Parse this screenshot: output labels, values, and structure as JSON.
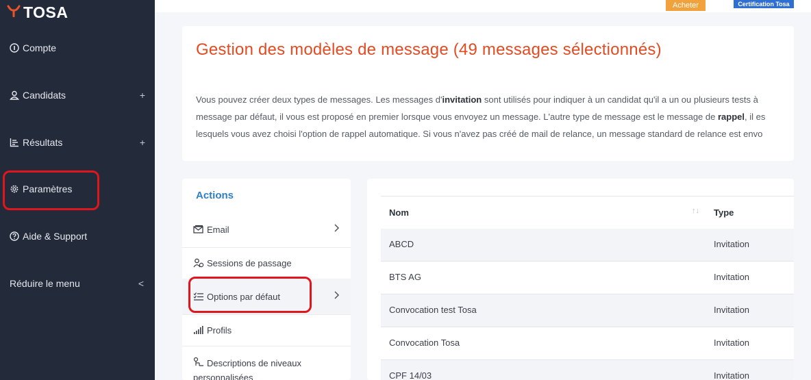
{
  "brand": {
    "name": "TOSA"
  },
  "topbar": {
    "buy_label": "Acheter",
    "cert_label": "Certification Tosa"
  },
  "sidebar": {
    "items": [
      {
        "label": "Compte",
        "icon": "info-circle-icon"
      },
      {
        "label": "Candidats",
        "icon": "user-icon",
        "expand": "+"
      },
      {
        "label": "Résultats",
        "icon": "bar-chart-icon",
        "expand": "+"
      },
      {
        "label": "Paramètres",
        "icon": "gear-icon"
      },
      {
        "label": "Aide & Support",
        "icon": "help-circle-icon"
      },
      {
        "label": "Réduire le menu",
        "expand": "<"
      }
    ]
  },
  "main": {
    "title": "Gestion des modèles de message (49 messages sélectionnés)",
    "description": {
      "line1_a": "Vous pouvez créer deux types de messages. Les messages d'",
      "line1_bold": "invitation",
      "line1_b": " sont utilisés pour indiquer à un candidat qu'il a un ou plusieurs tests à",
      "line2_a": "message par défaut, il vous est proposé en premier lorsque vous envoyez un message. L'autre type de message est le message de ",
      "line2_bold": "rappel",
      "line2_b": ", il es",
      "line3": "lesquels vous avez choisi l'option de rappel automatique. Si vous n'avez pas créé de mail de relance, un message standard de relance est envo"
    }
  },
  "actions": {
    "title": "Actions",
    "items": [
      {
        "label": "Email",
        "icon": "email-icon",
        "chevron": "›"
      },
      {
        "label": "Sessions de passage",
        "icon": "users-session-icon"
      },
      {
        "label": "Options par défaut",
        "icon": "checklist-icon",
        "chevron": "›"
      },
      {
        "label": "Profils",
        "icon": "signal-bars-icon"
      },
      {
        "label": "Descriptions de niveaux personnalisées",
        "label_line1": "Descriptions de niveaux",
        "label_line2": "personnalisées",
        "icon": "level-description-icon"
      }
    ]
  },
  "table": {
    "columns": {
      "name": "Nom",
      "type": "Type",
      "sort_glyph": "↑↓"
    },
    "rows": [
      {
        "name": "ABCD",
        "type": "Invitation"
      },
      {
        "name": "BTS AG",
        "type": "Invitation"
      },
      {
        "name": "Convocation test Tosa",
        "type": "Invitation"
      },
      {
        "name": "Convocation Tosa",
        "type": "Invitation"
      },
      {
        "name": "CPF 14/03",
        "type": "Invitation"
      }
    ]
  },
  "colors": {
    "sidebar_bg": "#232b3b",
    "accent_orange": "#e44b22",
    "actions_blue": "#2f7fc2",
    "buy_orange": "#f2a23c",
    "cert_blue": "#2f6fd1",
    "annotation_red": "#e0161e"
  }
}
